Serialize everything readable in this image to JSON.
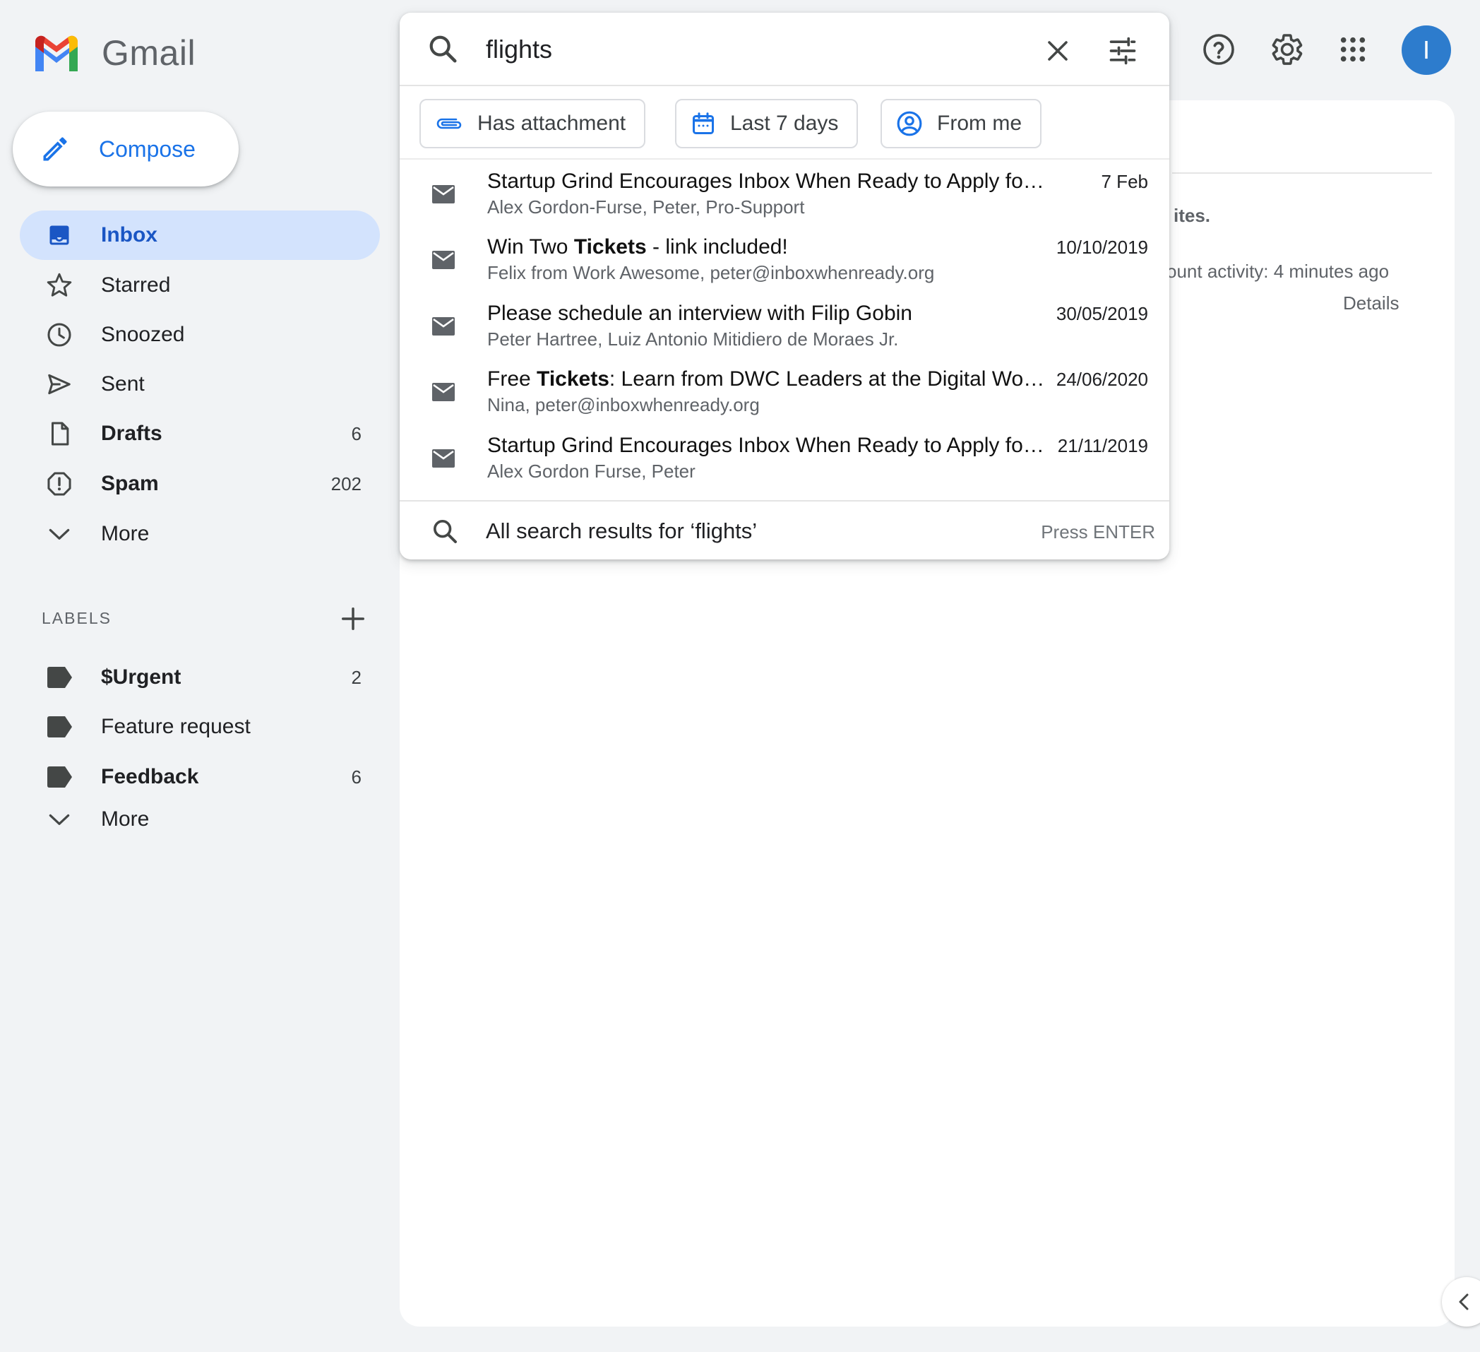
{
  "brand": {
    "name": "Gmail",
    "colors": {
      "red": "#ea4335",
      "blue": "#4285f4",
      "green": "#34a853",
      "yellow": "#fbbc04",
      "accent": "#1a73e8"
    }
  },
  "compose": {
    "label": "Compose"
  },
  "nav": [
    {
      "id": "inbox",
      "label": "Inbox",
      "count": "",
      "icon": "inbox-icon",
      "active": true
    },
    {
      "id": "starred",
      "label": "Starred",
      "count": "",
      "icon": "star-icon"
    },
    {
      "id": "snoozed",
      "label": "Snoozed",
      "count": "",
      "icon": "clock-icon"
    },
    {
      "id": "sent",
      "label": "Sent",
      "count": "",
      "icon": "send-icon"
    },
    {
      "id": "drafts",
      "label": "Drafts",
      "count": "6",
      "icon": "draft-icon",
      "bold": true
    },
    {
      "id": "spam",
      "label": "Spam",
      "count": "202",
      "icon": "spam-icon",
      "bold": true
    },
    {
      "id": "more",
      "label": "More",
      "count": "",
      "icon": "chevron-down-icon"
    }
  ],
  "labels": {
    "heading": "LABELS",
    "items": [
      {
        "label": "$Urgent",
        "count": "2",
        "bold": true
      },
      {
        "label": "Feature request",
        "count": ""
      },
      {
        "label": "Feedback",
        "count": "6",
        "bold": true
      }
    ],
    "more": "More"
  },
  "search": {
    "query": "flights",
    "chips": [
      {
        "label": "Has attachment",
        "icon": "paperclip-icon"
      },
      {
        "label": "Last 7 days",
        "icon": "calendar-icon"
      },
      {
        "label": "From me",
        "icon": "account-circle-icon"
      }
    ],
    "results": [
      {
        "subject_pre": "Startup Grind Encourages Inbox When Ready to Apply for Google for Startups",
        "subject_bold": "",
        "subject_post": "",
        "from": "Alex Gordon-Furse, Peter, Pro-Support",
        "date": "7 Feb"
      },
      {
        "subject_pre": "Win Two ",
        "subject_bold": "Tickets",
        "subject_post": " - link included!",
        "from": "Felix from Work Awesome, peter@inboxwhenready.org",
        "date": "10/10/2019"
      },
      {
        "subject_pre": "Please schedule an interview with Filip Gobin",
        "subject_bold": "",
        "subject_post": "",
        "from": "Peter Hartree, Luiz Antonio Mitidiero de Moraes Jr.",
        "date": "30/05/2019"
      },
      {
        "subject_pre": "Free ",
        "subject_bold": "Tickets",
        "subject_post": ": Learn from DWC Leaders at the Digital Workplace Conference",
        "from": "Nina, peter@inboxwhenready.org",
        "date": "24/06/2020"
      },
      {
        "subject_pre": "Startup Grind Encourages Inbox When Ready to Apply for Google for Startups",
        "subject_bold": "",
        "subject_post": "",
        "from": "Alex Gordon Furse, Peter",
        "date": "21/11/2019"
      }
    ],
    "all_results": "All search results for ‘flights’",
    "all_results_hint": "Press ENTER"
  },
  "background": {
    "text1": "ites.",
    "text2": "ount activity: 4 minutes ago",
    "details": "Details"
  },
  "avatar": {
    "initial": "I",
    "color": "#2d7ccd"
  }
}
